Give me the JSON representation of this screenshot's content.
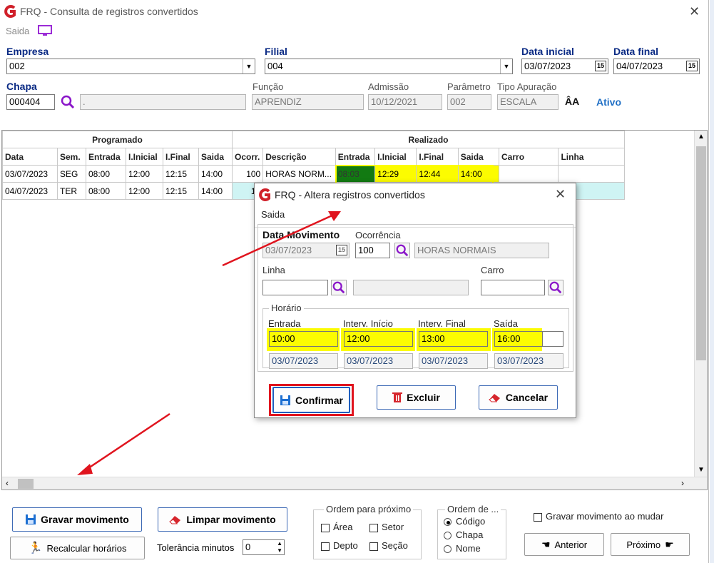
{
  "window": {
    "title": "FRQ - Consulta de registros convertidos",
    "menu_saida": "Saida"
  },
  "form": {
    "empresa_label": "Empresa",
    "empresa_value": "002",
    "filial_label": "Filial",
    "filial_value": "004",
    "data_inicial_label": "Data inicial",
    "data_inicial_value": "03/07/2023",
    "data_final_label": "Data final",
    "data_final_value": "04/07/2023",
    "chapa_label": "Chapa",
    "chapa_value": "000404",
    "nome_value": ".",
    "funcao_label": "Função",
    "funcao_value": "APRENDIZ",
    "admissao_label": "Admissão",
    "admissao_value": "10/12/2021",
    "parametro_label": "Parâmetro",
    "parametro_value": "002",
    "tipo_apuracao_label": "Tipo Apuração",
    "tipo_apuracao_value": "ESCALA",
    "status": "Ativo",
    "cal_icon": "15"
  },
  "grid": {
    "group_programado": "Programado",
    "group_realizado": "Realizado",
    "columns": [
      "Data",
      "Sem.",
      "Entrada",
      "I.Inicial",
      "I.Final",
      "Saida",
      "Ocorr.",
      "Descrição",
      "Entrada",
      "I.Inicial",
      "I.Final",
      "Saida",
      "Carro",
      "Linha"
    ],
    "rows": [
      [
        "03/07/2023",
        "SEG",
        "08:00",
        "12:00",
        "12:15",
        "14:00",
        "100",
        "HORAS NORM...",
        "08:03",
        "12:29",
        "12:44",
        "14:00",
        "",
        ""
      ],
      [
        "04/07/2023",
        "TER",
        "08:00",
        "12:00",
        "12:15",
        "14:00",
        "10",
        "",
        "",
        "",
        "",
        "",
        "",
        ""
      ]
    ]
  },
  "bottom": {
    "gravar_label": "Gravar movimento",
    "limpar_label": "Limpar movimento",
    "recalcular_label": "Recalcular horários",
    "tolerancia_label": "Tolerância minutos",
    "tolerancia_value": "0",
    "ordem_proximo_title": "Ordem para próximo",
    "opt_area": "Área",
    "opt_setor": "Setor",
    "opt_depto": "Depto",
    "opt_secao": "Seção",
    "ordem_de_title": "Ordem de ...",
    "radio_codigo": "Código",
    "radio_chapa": "Chapa",
    "radio_nome": "Nome",
    "gravar_ao_mudar": "Gravar movimento ao mudar",
    "anterior_label": "Anterior",
    "proximo_label": "Próximo"
  },
  "dialog": {
    "title": "FRQ - Altera registros convertidos",
    "menu_saida": "Saida",
    "data_movimento_label": "Data Movimento",
    "data_movimento_value": "03/07/2023",
    "ocorrencia_label": "Ocorrência",
    "ocorrencia_value": "100",
    "ocorrencia_desc": "HORAS NORMAIS",
    "linha_label": "Linha",
    "carro_label": "Carro",
    "horario_title": "Horário",
    "entrada_label": "Entrada",
    "interv_inicio_label": "Interv. Início",
    "interv_final_label": "Interv. Final",
    "saida_label": "Saída",
    "entrada_value": "10:00",
    "interv_inicio_value": "12:00",
    "interv_final_value": "13:00",
    "saida_value": "16:00",
    "entrada_date": "03/07/2023",
    "interv_inicio_date": "03/07/2023",
    "interv_final_date": "03/07/2023",
    "saida_date": "03/07/2023",
    "confirmar_label": "Confirmar",
    "excluir_label": "Excluir",
    "cancelar_label": "Cancelar"
  },
  "colors": {
    "highlight_yellow": "#fcfc00",
    "annotation_red": "#e0141e",
    "label_blue": "#0a2a84"
  }
}
